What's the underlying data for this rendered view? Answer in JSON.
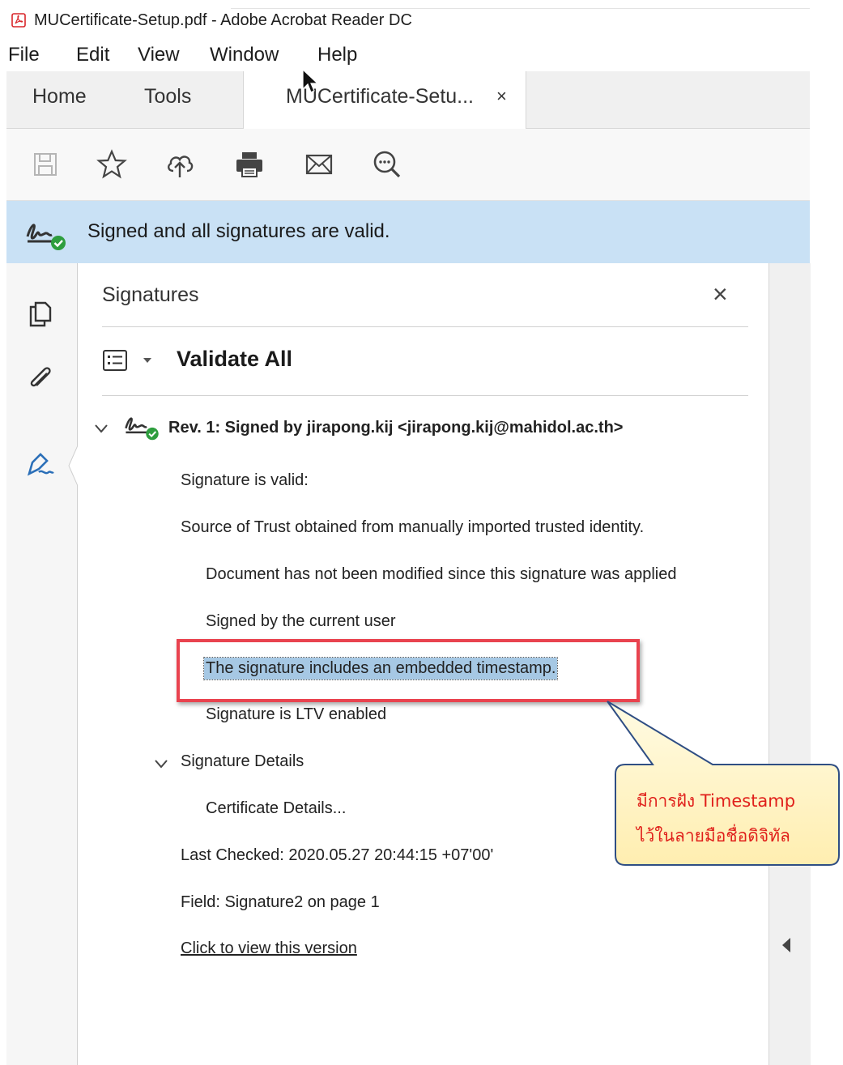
{
  "window": {
    "title": "MUCertificate-Setup.pdf - Adobe Acrobat Reader DC"
  },
  "menu": [
    "File",
    "Edit",
    "View",
    "Window",
    "Help"
  ],
  "tabs": {
    "home": "Home",
    "tools": "Tools",
    "document": "MUCertificate-Setu...",
    "close": "×"
  },
  "toolbar": {
    "icons": [
      "save-icon",
      "star-icon",
      "cloud-upload-icon",
      "print-icon",
      "mail-icon",
      "zoom-icon"
    ]
  },
  "banner": {
    "message": "Signed and all signatures are valid."
  },
  "panel": {
    "title": "Signatures",
    "close": "×",
    "validate_all": "Validate All",
    "revision": "Rev. 1: Signed by jirapong.kij <jirapong.kij@mahidol.ac.th>",
    "signature_valid": "Signature is valid:",
    "source_of_trust": "Source of Trust obtained from manually imported trusted identity.",
    "not_modified": "Document has not been modified since this signature was applied",
    "signed_by_current": "Signed by the current user",
    "timestamp": "The signature includes an embedded timestamp.",
    "ltv": "Signature is LTV enabled",
    "details": "Signature Details",
    "certificate_details": "Certificate Details...",
    "last_checked": "Last Checked: 2020.05.27 20:44:15 +07'00'",
    "field": "Field: Signature2 on page 1",
    "view_version": "Click to view this version"
  },
  "callout": {
    "line1": "มีการฝัง Timestamp",
    "line2": "ไว้ในลายมือชื่อดิจิทัล"
  },
  "colors": {
    "banner_bg": "#c9e1f5",
    "highlight_border": "#e9434f",
    "callout_bg": "#fff2c4",
    "callout_text": "#e0201b",
    "valid_green": "#2e9e3e"
  }
}
